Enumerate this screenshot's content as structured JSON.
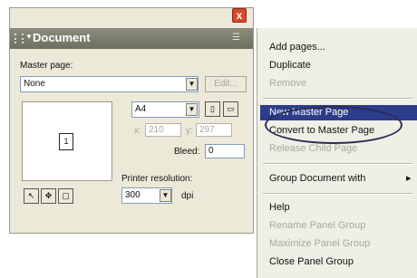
{
  "panel": {
    "title": "Document",
    "close_glyph": "x",
    "master_page_label": "Master page:",
    "master_page_value": "None",
    "edit_button": "Edit...",
    "page_size_value": "A4",
    "width_prefix": "x:",
    "width_value": "210",
    "height_prefix": "y:",
    "height_value": "297",
    "bleed_label": "Bleed:",
    "bleed_value": "0",
    "printer_resolution_label": "Printer resolution:",
    "printer_resolution_value": "300",
    "dpi_label": "dpi",
    "page_number": "1"
  },
  "context_menu": {
    "items": [
      {
        "label": "Add pages...",
        "enabled": true
      },
      {
        "label": "Duplicate",
        "enabled": true
      },
      {
        "label": "Remove",
        "enabled": false
      },
      {
        "label": "New Master Page",
        "enabled": true,
        "highlighted": true
      },
      {
        "label": "Convert to Master Page",
        "enabled": true
      },
      {
        "label": "Release Child Page",
        "enabled": false
      },
      {
        "label": "Group Document with",
        "enabled": true,
        "submenu": true
      },
      {
        "label": "Help",
        "enabled": true
      },
      {
        "label": "Rename Panel Group",
        "enabled": false
      },
      {
        "label": "Maximize Panel Group",
        "enabled": false
      },
      {
        "label": "Close Panel Group",
        "enabled": true
      }
    ],
    "submenu_glyph": "▸"
  },
  "colors": {
    "title_bar": "#7a7a6c",
    "highlight": "#2c3d8c",
    "disabled_text": "#a9a89e",
    "close_button": "#d9482b"
  },
  "icons": [
    "close-icon",
    "collapse-arrow-icon",
    "panel-menu-icon",
    "dropdown-arrow-icon",
    "portrait-icon",
    "landscape-icon",
    "page-tool-icon",
    "grab-tool-icon",
    "rectangle-tool-icon",
    "submenu-arrow-icon"
  ]
}
